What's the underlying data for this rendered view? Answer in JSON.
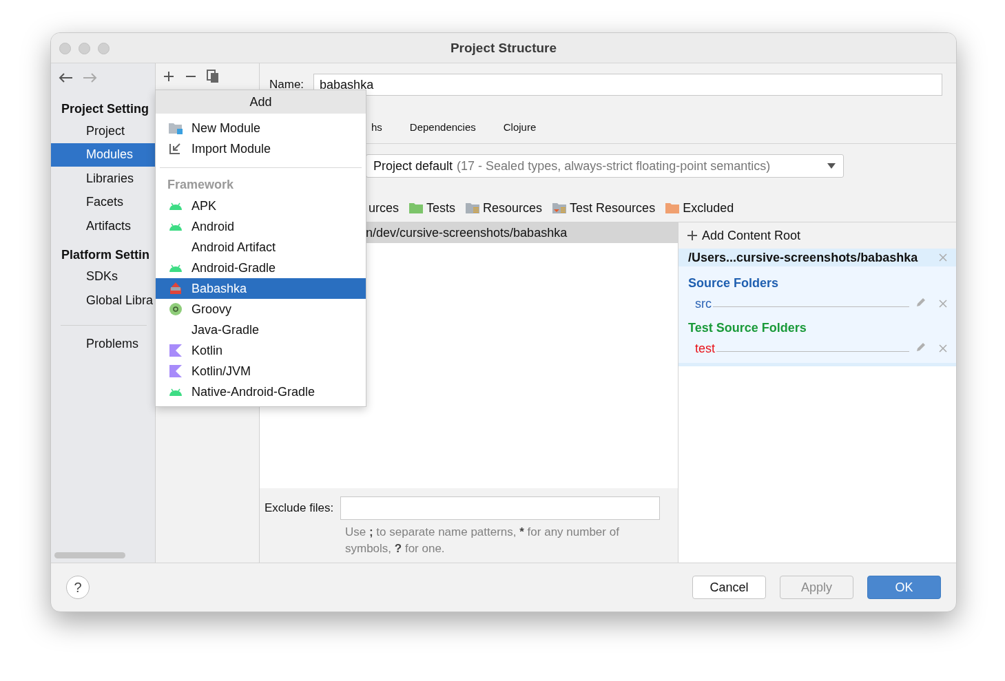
{
  "window": {
    "title": "Project Structure"
  },
  "sidebar": {
    "sections": [
      {
        "title": "Project Setting",
        "items": [
          {
            "label": "Project",
            "selected": false
          },
          {
            "label": "Modules",
            "selected": true
          },
          {
            "label": "Libraries",
            "selected": false
          },
          {
            "label": "Facets",
            "selected": false
          },
          {
            "label": "Artifacts",
            "selected": false
          }
        ]
      },
      {
        "title": "Platform Settin",
        "items": [
          {
            "label": "SDKs",
            "selected": false
          },
          {
            "label": "Global Libra",
            "selected": false
          }
        ]
      }
    ],
    "problems": "Problems"
  },
  "module": {
    "name_label": "Name:",
    "name_value": "babashka",
    "tabs": [
      {
        "label": "hs",
        "selected": false
      },
      {
        "label": "Dependencies",
        "selected": false
      },
      {
        "label": "Clojure",
        "selected": false
      }
    ],
    "language_level": {
      "value": "Project default",
      "detail": "(17 - Sealed types, always-strict floating-point semantics)"
    },
    "mark_as": [
      {
        "label": "urces",
        "kind": "plain"
      },
      {
        "label": "Tests",
        "kind": "tests"
      },
      {
        "label": "Resources",
        "kind": "resources"
      },
      {
        "label": "Test Resources",
        "kind": "test-resources"
      },
      {
        "label": "Excluded",
        "kind": "excluded"
      }
    ],
    "tree_row": {
      "label": "n/dev/cursive-screenshots/babashka",
      "selected": true
    },
    "exclude": {
      "label": "Exclude files:",
      "hint": [
        {
          "text": "Use "
        },
        {
          "text": ";",
          "bold": true
        },
        {
          "text": " to separate name patterns, "
        },
        {
          "text": "*",
          "bold": true
        },
        {
          "text": " for any number of symbols, "
        },
        {
          "text": "?",
          "bold": true
        },
        {
          "text": " for one."
        }
      ]
    }
  },
  "content_root": {
    "add_label": "Add Content Root",
    "path": "/Users...cursive-screenshots/babashka",
    "sections": [
      {
        "kind": "source",
        "title": "Source Folders",
        "folders": [
          "src"
        ]
      },
      {
        "kind": "test",
        "title": "Test Source Folders",
        "folders": [
          "test"
        ]
      }
    ]
  },
  "popup": {
    "title": "Add",
    "items": [
      {
        "kind": "new-module",
        "label": "New Module",
        "selected": false
      },
      {
        "kind": "import",
        "label": "Import Module",
        "selected": false
      },
      {
        "kind": "separator"
      },
      {
        "kind": "header",
        "label": "Framework"
      },
      {
        "kind": "android",
        "label": "APK",
        "selected": false
      },
      {
        "kind": "android",
        "label": "Android",
        "selected": false
      },
      {
        "kind": "none",
        "label": "Android Artifact",
        "selected": false
      },
      {
        "kind": "android",
        "label": "Android-Gradle",
        "selected": false
      },
      {
        "kind": "babashka",
        "label": "Babashka",
        "selected": true
      },
      {
        "kind": "groovy",
        "label": "Groovy",
        "selected": false
      },
      {
        "kind": "none",
        "label": "Java-Gradle",
        "selected": false
      },
      {
        "kind": "kotlin",
        "label": "Kotlin",
        "selected": false
      },
      {
        "kind": "kotlin",
        "label": "Kotlin/JVM",
        "selected": false
      },
      {
        "kind": "android",
        "label": "Native-Android-Gradle",
        "selected": false
      }
    ]
  },
  "footer": {
    "help": "?",
    "buttons": [
      {
        "label": "Cancel",
        "kind": "default",
        "disabled": false
      },
      {
        "label": "Apply",
        "kind": "default",
        "disabled": true
      },
      {
        "label": "OK",
        "kind": "primary",
        "disabled": false
      }
    ]
  }
}
